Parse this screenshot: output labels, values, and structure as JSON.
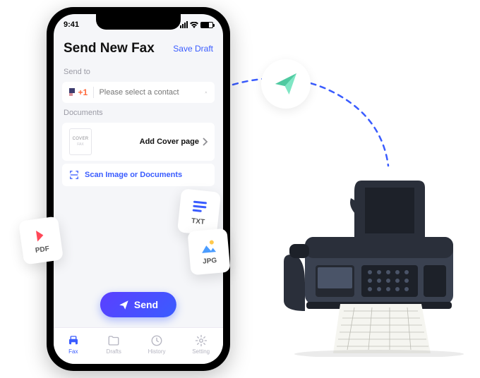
{
  "statusBar": {
    "time": "9:41"
  },
  "header": {
    "title": "Send New Fax",
    "saveDraft": "Save Draft"
  },
  "sendTo": {
    "label": "Send to",
    "countryCode": "+1",
    "placeholder": "Please select a contact"
  },
  "documents": {
    "label": "Documents",
    "coverThumb": "COVER",
    "coverThumbSub": "FAX",
    "addCover": "Add Cover page"
  },
  "scan": {
    "label": "Scan Image or Documents"
  },
  "sendButton": {
    "label": "Send"
  },
  "tabs": {
    "fax": "Fax",
    "drafts": "Drafts",
    "history": "History",
    "setting": "Setting"
  },
  "fileCards": {
    "pdf": "PDF",
    "txt": "TXT",
    "jpg": "JPG"
  }
}
